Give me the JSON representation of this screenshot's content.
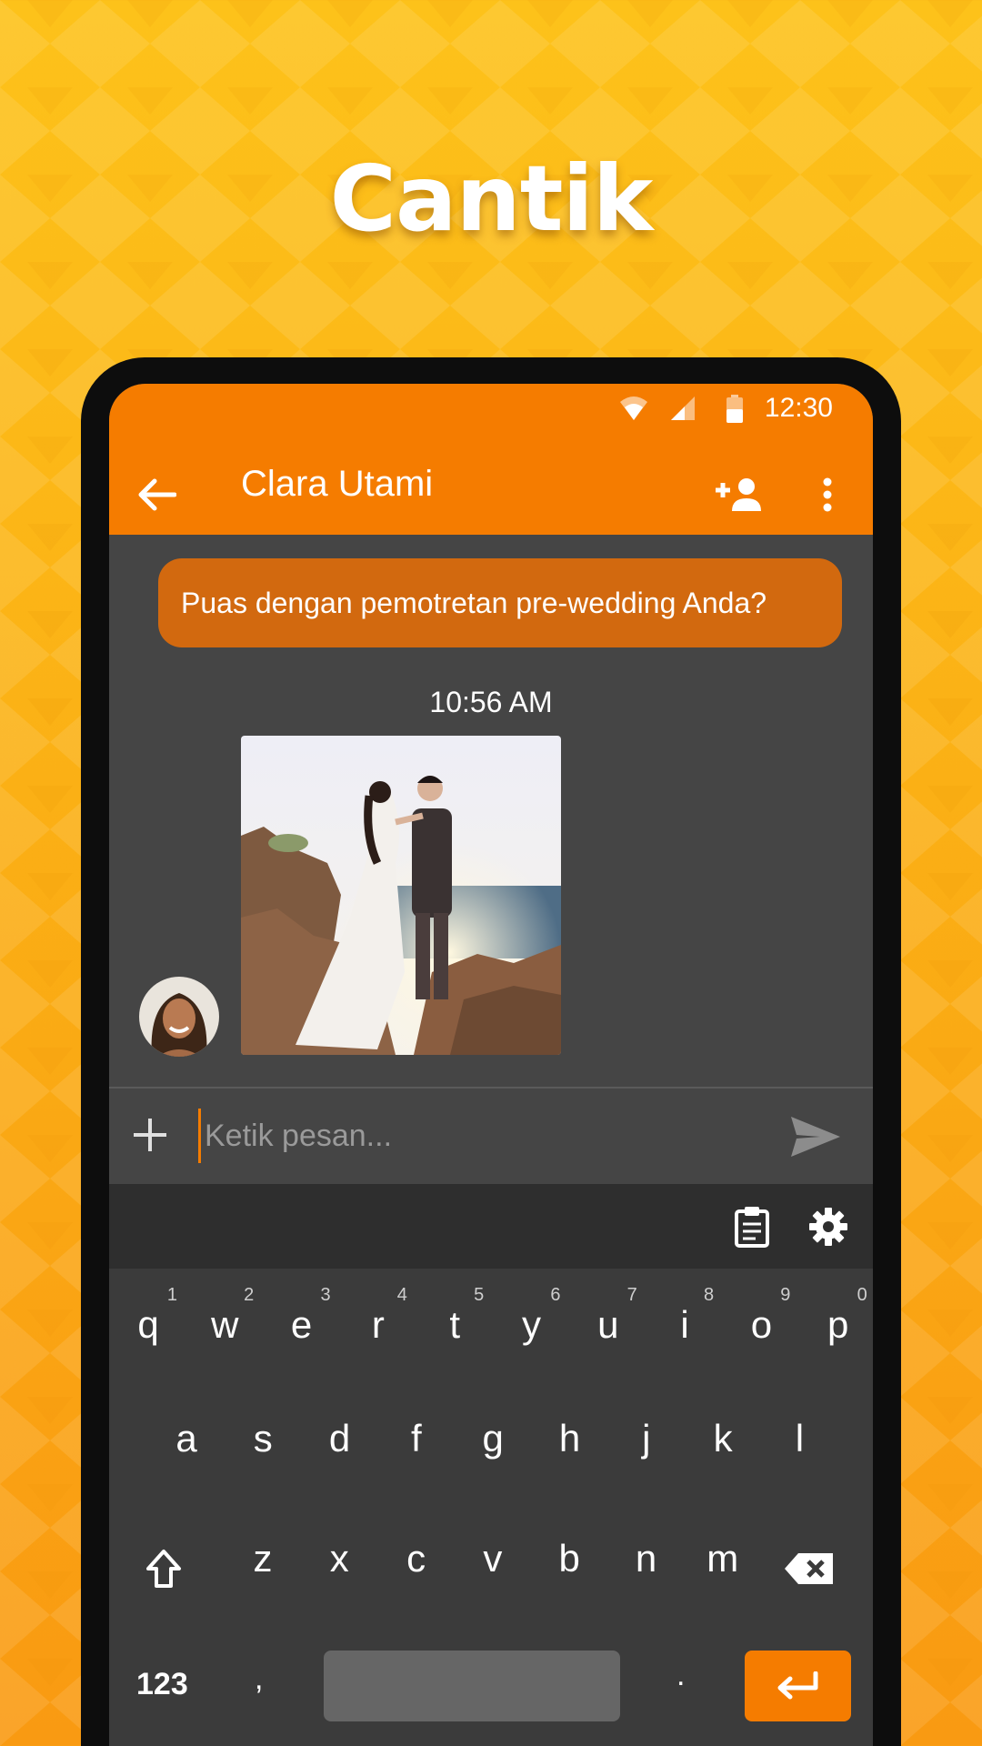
{
  "headline": "Cantik",
  "status_bar": {
    "time": "12:30"
  },
  "app_bar": {
    "title": "Clara Utami",
    "back_icon": "arrow-back-icon",
    "add_contact_icon": "person-add-icon",
    "more_icon": "more-vertical-icon"
  },
  "conversation": {
    "outgoing_message": "Puas dengan pemotretan pre-wedding Anda?",
    "timestamp": "10:56 AM",
    "incoming_photo": "wedding-couple-photo",
    "sender_avatar": "avatar-photo"
  },
  "compose": {
    "placeholder": "Ketik pesan...",
    "attach_icon": "plus-icon",
    "send_icon": "send-icon"
  },
  "keyboard": {
    "toolbar_icons": [
      "clipboard-icon",
      "gear-icon"
    ],
    "row1": [
      {
        "ch": "q",
        "hint": "1"
      },
      {
        "ch": "w",
        "hint": "2"
      },
      {
        "ch": "e",
        "hint": "3"
      },
      {
        "ch": "r",
        "hint": "4"
      },
      {
        "ch": "t",
        "hint": "5"
      },
      {
        "ch": "y",
        "hint": "6"
      },
      {
        "ch": "u",
        "hint": "7"
      },
      {
        "ch": "i",
        "hint": "8"
      },
      {
        "ch": "o",
        "hint": "9"
      },
      {
        "ch": "p",
        "hint": "0"
      }
    ],
    "row2": [
      "a",
      "s",
      "d",
      "f",
      "g",
      "h",
      "j",
      "k",
      "l"
    ],
    "row3": [
      "z",
      "x",
      "c",
      "v",
      "b",
      "n",
      "m"
    ],
    "symbols_key": "123",
    "comma_key": ",",
    "period_key": "."
  },
  "colors": {
    "accent": "#f57c00",
    "background_yellow": "#fbb015",
    "dark_surface": "#454545"
  }
}
